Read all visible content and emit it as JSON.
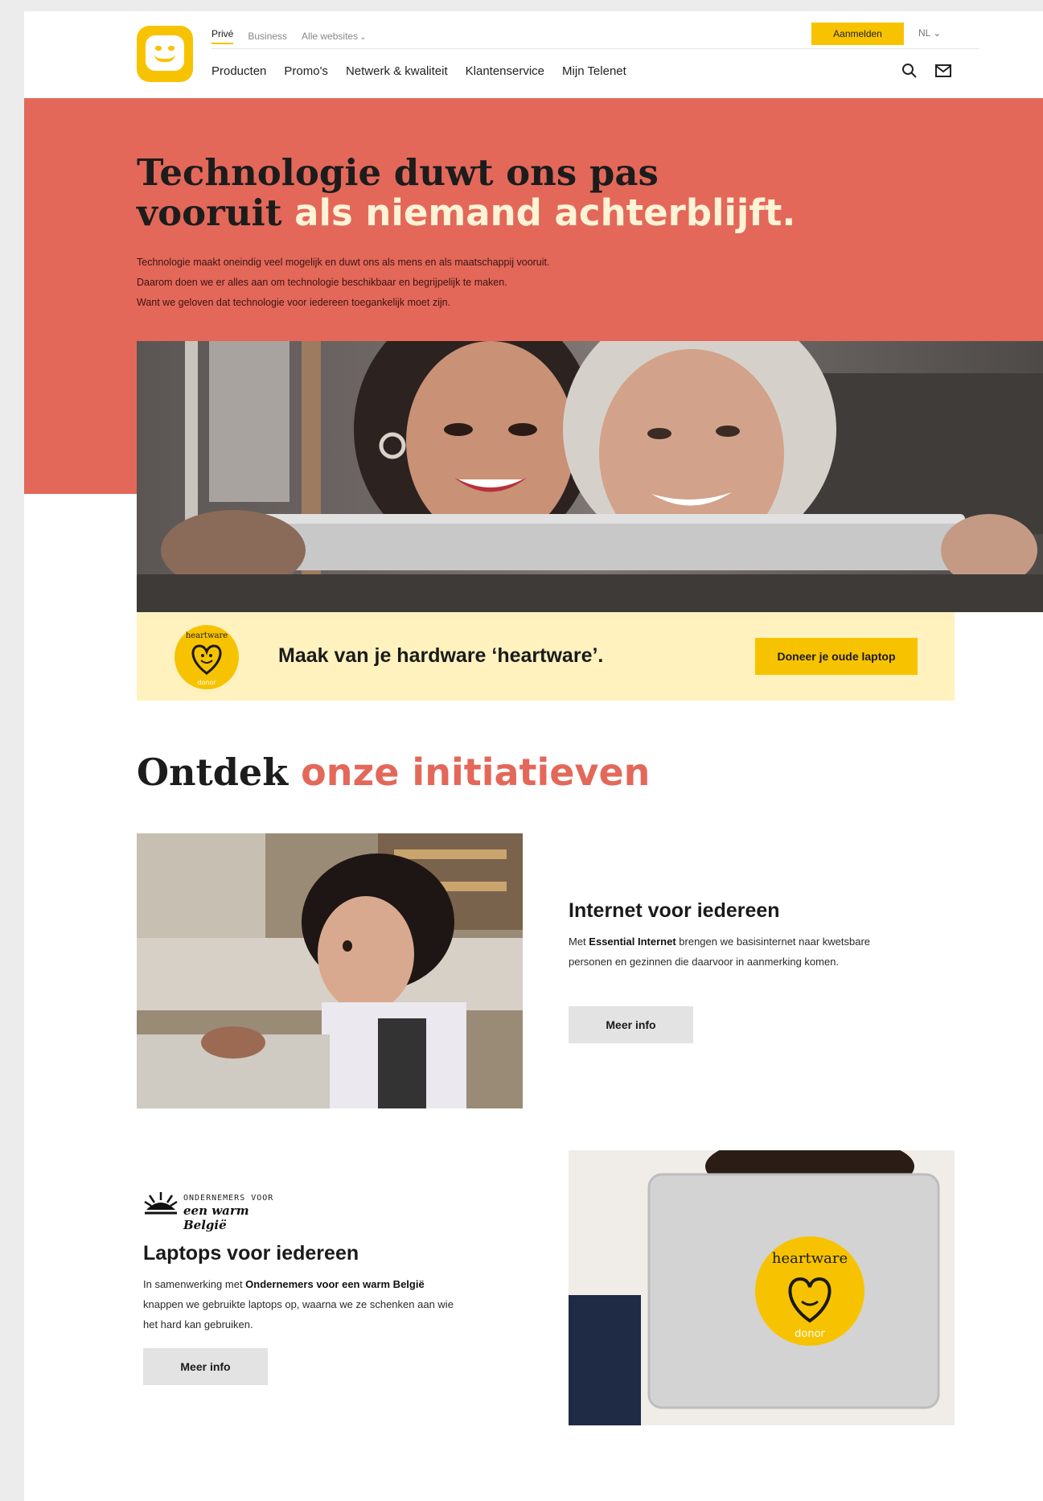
{
  "header": {
    "topnav": [
      {
        "label": "Privé",
        "active": true
      },
      {
        "label": "Business",
        "active": false
      },
      {
        "label": "Alle websites",
        "active": false
      }
    ],
    "mainnav": [
      "Producten",
      "Promo's",
      "Netwerk & kwaliteit",
      "Klantenservice",
      "Mijn Telenet"
    ],
    "login_label": "Aanmelden",
    "language": "NL",
    "icons": [
      "search-icon",
      "mail-icon",
      "chevron-down-icon"
    ]
  },
  "hero": {
    "title_line1": "Technologie duwt ons pas",
    "title_line2_plain": "vooruit ",
    "title_line2_accent": "als niemand achterblijft.",
    "text_line1": "Technologie maakt oneindig veel mogelijk en duwt ons als mens en als maatschappij vooruit.",
    "text_line2": "Daarom doen we er alles aan om technologie beschikbaar en begrijpelijk te maken.",
    "text_line3": "Want we geloven dat technologie voor iedereen toegankelijk moet zijn."
  },
  "banner": {
    "badge_top": "heartware",
    "badge_bottom": "donor",
    "title": "Maak van je hardware ‘heartware’.",
    "button": "Doneer je oude laptop"
  },
  "initiatives": {
    "title_plain": "Ontdek ",
    "title_accent": "onze initiatieven",
    "card1": {
      "title": "Internet voor iedereen",
      "text_pre": "Met ",
      "text_bold": "Essential Internet",
      "text_post": " brengen we basisinternet naar kwetsbare personen en gezinnen die daarvoor in aanmerking komen.",
      "button": "Meer info"
    },
    "card2": {
      "logo_line1": "ONDERNEMERS VOOR",
      "logo_line2": "een warm België",
      "title": "Laptops voor iedereen",
      "text_pre": "In samenwerking met ",
      "text_bold": "Ondernemers voor een warm België",
      "text_post": " knappen we gebruikte laptops op, waarna we ze schenken aan wie het hard kan gebruiken.",
      "button": "Meer info",
      "sticker_top": "heartware",
      "sticker_bottom": "donor"
    }
  },
  "colors": {
    "brand_yellow": "#f7c300",
    "coral": "#e3685a",
    "cream": "#fff2bf"
  }
}
